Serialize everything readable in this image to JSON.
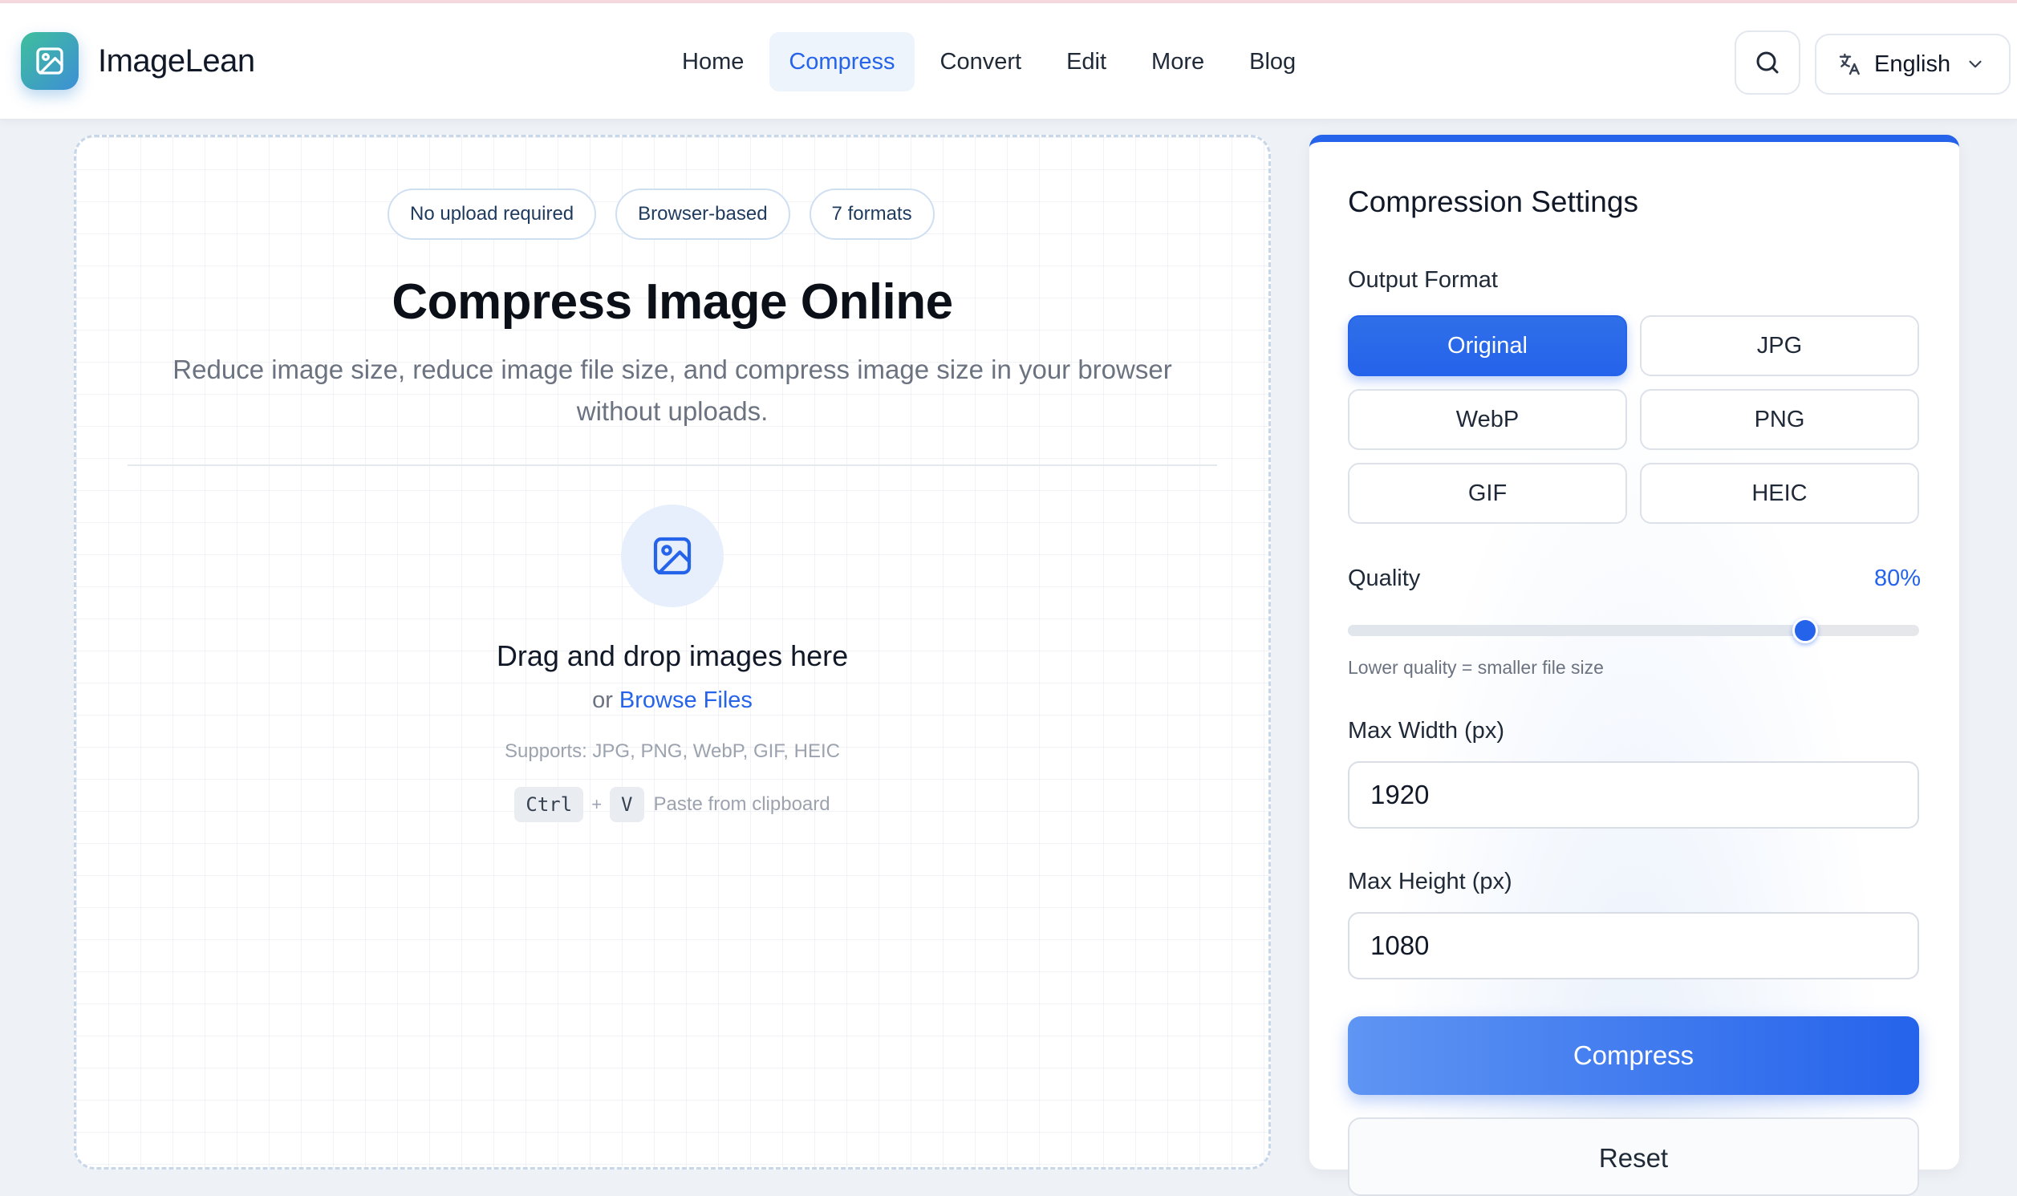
{
  "header": {
    "brand": "ImageLean",
    "nav": [
      {
        "label": "Home",
        "active": false
      },
      {
        "label": "Compress",
        "active": true
      },
      {
        "label": "Convert",
        "active": false
      },
      {
        "label": "Edit",
        "active": false
      },
      {
        "label": "More",
        "active": false
      },
      {
        "label": "Blog",
        "active": false
      }
    ],
    "language": "English",
    "icons": {
      "logo": "image-icon",
      "search": "search-icon",
      "language": "translate-icon",
      "dropdown": "chevron-down-icon"
    }
  },
  "upload": {
    "chips": [
      "No upload required",
      "Browser-based",
      "7 formats"
    ],
    "title": "Compress Image Online",
    "subtitle": "Reduce image size, reduce image file size, and compress image size in your browser without uploads.",
    "drop_title": "Drag and drop images here",
    "or_text": "or",
    "browse_label": "Browse Files",
    "supports": "Supports: JPG, PNG, WebP, GIF, HEIC",
    "kbd_ctrl": "Ctrl",
    "kbd_plus": "+",
    "kbd_v": "V",
    "paste_label": "Paste from clipboard"
  },
  "settings": {
    "title": "Compression Settings",
    "output_format_label": "Output Format",
    "formats": [
      "Original",
      "JPG",
      "WebP",
      "PNG",
      "GIF",
      "HEIC"
    ],
    "selected_format": "Original",
    "quality_label": "Quality",
    "quality_value_text": "80%",
    "quality_fraction": 0.8,
    "quality_hint": "Lower quality = smaller file size",
    "max_width_label": "Max Width (px)",
    "max_width_value": "1920",
    "max_height_label": "Max Height (px)",
    "max_height_value": "1080",
    "compress_label": "Compress",
    "reset_label": "Reset"
  },
  "colors": {
    "accent": "#2563eb",
    "brand_start": "#3fbf9c",
    "brand_end": "#3d8fd6"
  }
}
